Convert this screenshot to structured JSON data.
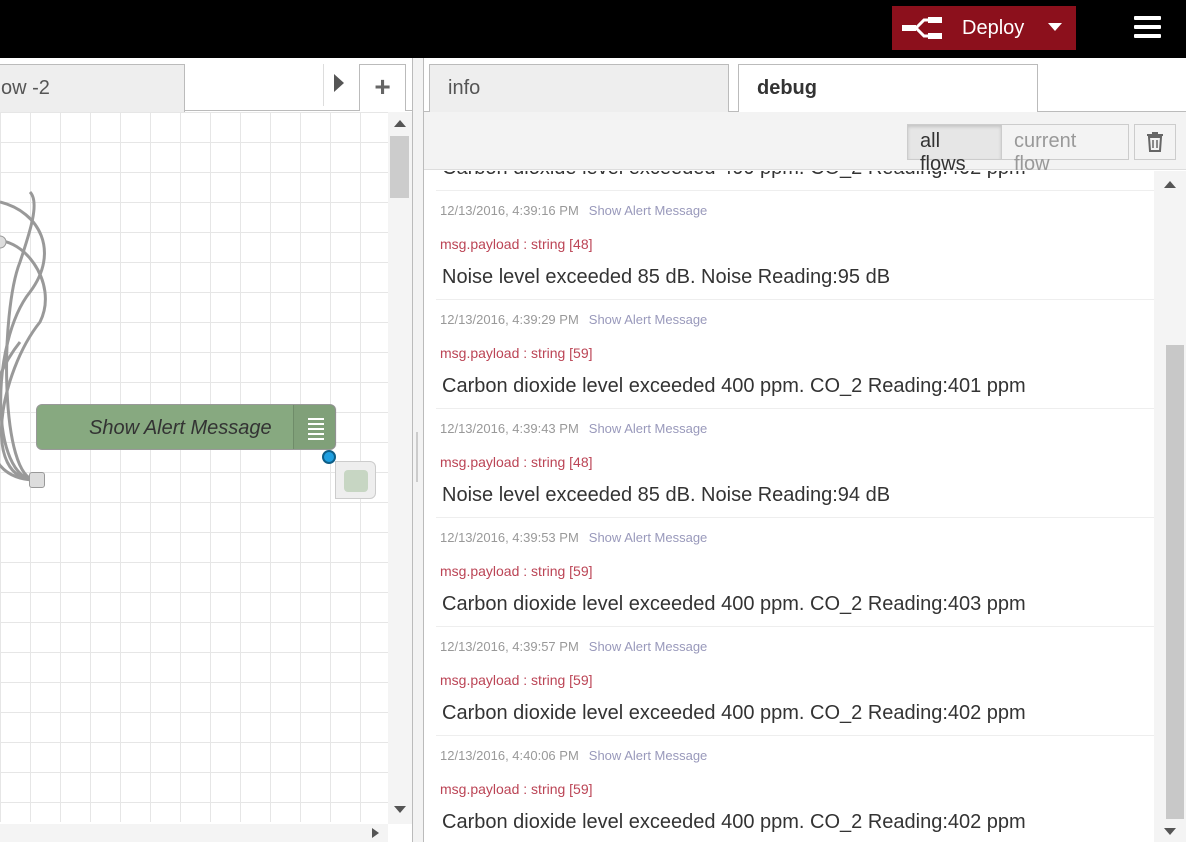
{
  "header": {
    "deploy_label": "Deploy",
    "deploy_icon": "deploy-icon",
    "menu_icon": "hamburger-menu-icon",
    "accent_color": "#8c101c"
  },
  "workspace": {
    "tab_label": "ow -2",
    "add_tab_label": "+",
    "node": {
      "label": "Show Alert Message",
      "color": "#87a980",
      "icon": "debug-icon"
    }
  },
  "sidebar": {
    "tabs": [
      {
        "label": "info"
      },
      {
        "label": "debug"
      }
    ],
    "filters": {
      "all_flows": "all flows",
      "current_flow": "current flow"
    },
    "clear_icon": "trash-icon",
    "partial_message": "Carbon dioxide level exceeded 400 ppm. CO_2 Reading:402 ppm",
    "messages": [
      {
        "timestamp": "12/13/2016, 4:39:16 PM",
        "source": "Show Alert Message",
        "type": "msg.payload : string [48]",
        "body": "Noise level exceeded 85 dB. Noise Reading:95 dB"
      },
      {
        "timestamp": "12/13/2016, 4:39:29 PM",
        "source": "Show Alert Message",
        "type": "msg.payload : string [59]",
        "body": "Carbon dioxide level exceeded 400 ppm. CO_2 Reading:401 ppm"
      },
      {
        "timestamp": "12/13/2016, 4:39:43 PM",
        "source": "Show Alert Message",
        "type": "msg.payload : string [48]",
        "body": "Noise level exceeded 85 dB. Noise Reading:94 dB"
      },
      {
        "timestamp": "12/13/2016, 4:39:53 PM",
        "source": "Show Alert Message",
        "type": "msg.payload : string [59]",
        "body": "Carbon dioxide level exceeded 400 ppm. CO_2 Reading:403 ppm"
      },
      {
        "timestamp": "12/13/2016, 4:39:57 PM",
        "source": "Show Alert Message",
        "type": "msg.payload : string [59]",
        "body": "Carbon dioxide level exceeded 400 ppm. CO_2 Reading:402 ppm"
      },
      {
        "timestamp": "12/13/2016, 4:40:06 PM",
        "source": "Show Alert Message",
        "type": "msg.payload : string [59]",
        "body": "Carbon dioxide level exceeded 400 ppm. CO_2 Reading:402 ppm"
      }
    ]
  }
}
